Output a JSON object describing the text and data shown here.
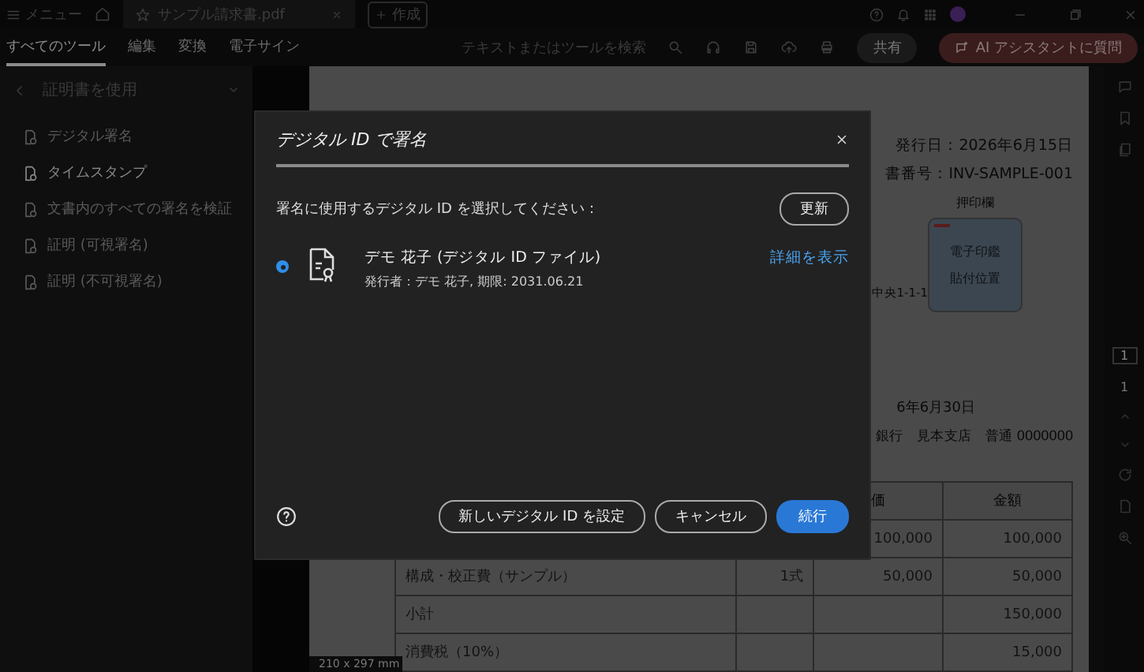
{
  "top_bar": {
    "menu": "メニュー",
    "tab": {
      "title": "サンプル請求書.pdf"
    },
    "create_button": "作成"
  },
  "toolbar": {
    "tabs": [
      {
        "label": "すべてのツール",
        "selected": true
      },
      {
        "label": "編集",
        "selected": false
      },
      {
        "label": "変換",
        "selected": false
      },
      {
        "label": "電子サイン",
        "selected": false
      }
    ],
    "search": {
      "placeholder": "テキストまたはツールを検索"
    },
    "share_button": "共有",
    "ai_button": "AI アシスタントに質問"
  },
  "sidebar": {
    "title": "証明書を使用",
    "items": [
      {
        "label": "デジタル署名",
        "disabled": true
      },
      {
        "label": "タイムスタンプ",
        "disabled": false
      },
      {
        "label": "文書内のすべての署名を検証",
        "disabled": true
      },
      {
        "label": "証明 (可視署名)",
        "disabled": true
      },
      {
        "label": "証明 (不可視署名)",
        "disabled": true
      }
    ]
  },
  "document": {
    "issue_date": "発行日：2026年6月15日",
    "invoice_number": "書番号：INV-SAMPLE-001",
    "stamp_label": "押印欄",
    "stamp_lines": [
      "電子印鑑",
      "貼付位置"
    ],
    "address_fragment": "中央1-1-1",
    "due_date": "6年6月30日",
    "bank": "銀行　見本支店　普通 0000000",
    "table": {
      "columns": {
        "column_3": "価",
        "column_4": "金額"
      },
      "rows": [
        {
          "column_3": "100,000",
          "column_4": "100,000"
        },
        {
          "column_1": "構成・校正費（サンプル）",
          "column_2": "1式",
          "column_3": "50,000",
          "column_4": "50,000"
        },
        {
          "column_1": "小計",
          "column_4": "150,000"
        },
        {
          "column_1": "消費税（10%）",
          "column_4": "15,000"
        }
      ]
    },
    "page_size": "210 x 297 mm"
  },
  "page_nav": {
    "current_page": "1",
    "total_pages": "1"
  },
  "dialog": {
    "title": "デジタル ID で署名",
    "prompt": "署名に使用するデジタル ID を選択してください：",
    "refresh_button": "更新",
    "ids": [
      {
        "name": "デモ 花子 (デジタル ID ファイル)",
        "issuer": "発行者：デモ 花子, 期限: 2031.06.21",
        "selected": true
      }
    ],
    "details_link": "詳細を表示",
    "buttons": [
      {
        "label": "新しいデジタル ID を設定",
        "kind": "secondary"
      },
      {
        "label": "キャンセル",
        "kind": "secondary"
      },
      {
        "label": "続行",
        "kind": "primary"
      }
    ]
  }
}
